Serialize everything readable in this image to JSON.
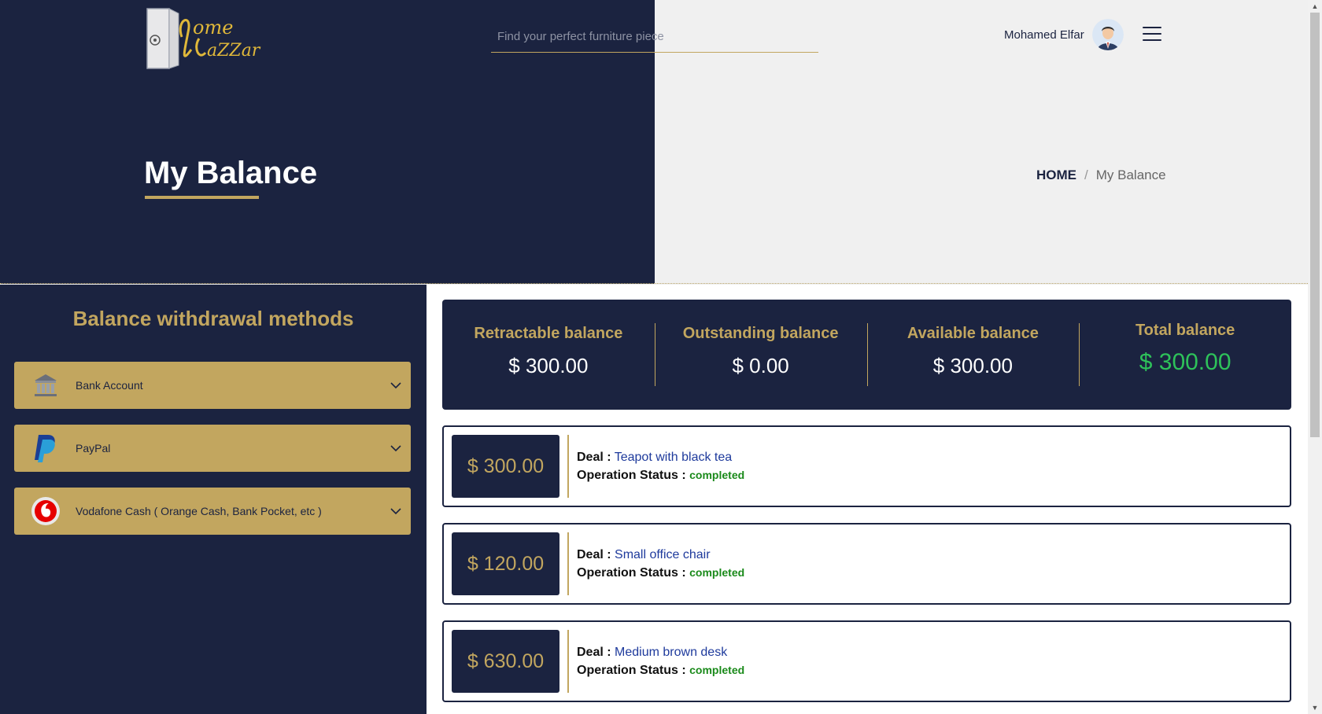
{
  "header": {
    "search_placeholder": "Find your perfect furniture piece",
    "user_name": "Mohamed Elfar"
  },
  "hero": {
    "title": "My Balance",
    "breadcrumb": {
      "home": "HOME",
      "separator": "/",
      "current": "My Balance"
    }
  },
  "withdrawal": {
    "title": "Balance withdrawal methods",
    "methods": [
      {
        "label": "Bank Account",
        "icon": "bank-icon"
      },
      {
        "label": "PayPal",
        "icon": "paypal-icon"
      },
      {
        "label": "Vodafone Cash ( Orange Cash, Bank Pocket, etc )",
        "icon": "vodafone-icon"
      }
    ]
  },
  "balances": {
    "retractable": {
      "label": "Retractable balance",
      "value": "$ 300.00"
    },
    "outstanding": {
      "label": "Outstanding balance",
      "value": "$ 0.00"
    },
    "available": {
      "label": "Available balance",
      "value": "$ 300.00"
    },
    "total": {
      "label": "Total balance",
      "value": "$ 300.00"
    }
  },
  "deals": {
    "deal_label": "Deal :",
    "status_label": "Operation Status :",
    "items": [
      {
        "amount": "$ 300.00",
        "name": "Teapot with black tea",
        "status": "completed"
      },
      {
        "amount": "$ 120.00",
        "name": "Small office chair",
        "status": "completed"
      },
      {
        "amount": "$ 630.00",
        "name": "Medium brown desk",
        "status": "completed"
      }
    ]
  },
  "colors": {
    "navy": "#1b2340",
    "gold": "#c2a65f",
    "green": "#2ec25a",
    "link_blue": "#1e3a9c"
  }
}
